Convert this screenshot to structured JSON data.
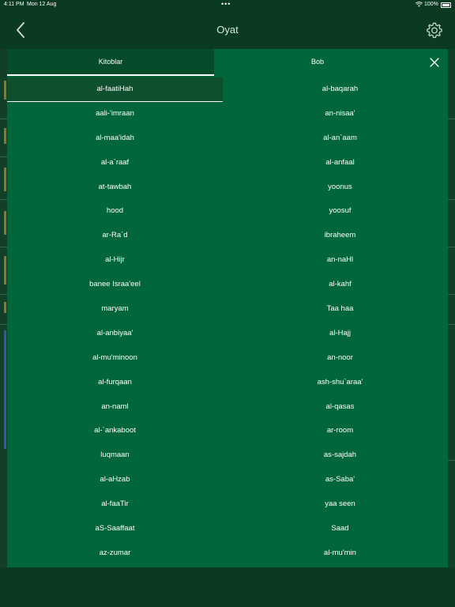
{
  "status_bar": {
    "time": "4:11 PM",
    "date": "Mon 12 Aug",
    "dots": "•••",
    "battery": "100%"
  },
  "nav": {
    "title": "Oyat",
    "back_icon": "chevron-left-icon",
    "settings_icon": "gear-icon"
  },
  "tabs": {
    "books_label": "Kitoblar",
    "chapters_label": "Bob",
    "active": "books"
  },
  "left_items": [
    "al-faatiHah",
    "aali-'imraan",
    "al-maa'idah",
    "al-a`raaf",
    "at-tawbah",
    "hood",
    "ar-Ra`d",
    "al-Hijr",
    "banee Israa'eel",
    "maryam",
    "al-anbiyaa'",
    "al-mu'minoon",
    "al-furqaan",
    "an-naml",
    "al-`ankaboot",
    "luqmaan",
    "al-aHzab",
    "al-faaTir",
    "aS-Saaffaat",
    "az-zumar"
  ],
  "right_items": [
    "al-baqarah",
    "an-nisaa'",
    "al-an`aam",
    "al-anfaal",
    "yoonus",
    "yoosuf",
    "ibraheem",
    "an-naHl",
    "al-kahf",
    "Taa haa",
    "al-Hajj",
    "an-noor",
    "ash-shu`araa'",
    "al-qasas",
    "ar-room",
    "as-sajdah",
    "as-Saba'",
    "yaa seen",
    "Saad",
    "al-mu'min"
  ],
  "selected_index": 0,
  "colors": {
    "background": "#0b3a22",
    "modal": "#01663a",
    "active_tab": "#064b2a",
    "text": "#ffffff"
  }
}
